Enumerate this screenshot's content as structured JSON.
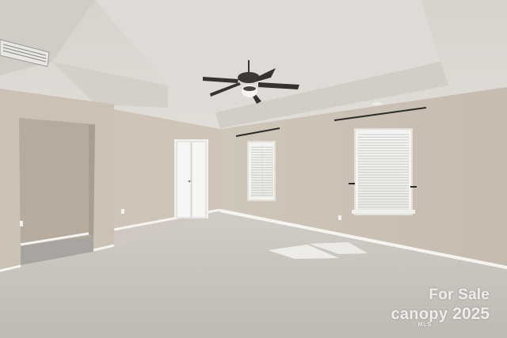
{
  "scene": {
    "description_colors": {
      "ceiling": "#d9d5cf",
      "wall": "#cbc2b6",
      "carpet": "#c9c5c0",
      "trim": "#ffffff",
      "closet_shadow": "#b8ad9f"
    }
  },
  "watermark": {
    "line1": "For Sale",
    "brand": "canopy",
    "brand_sub": "MLS",
    "year": "2025"
  }
}
